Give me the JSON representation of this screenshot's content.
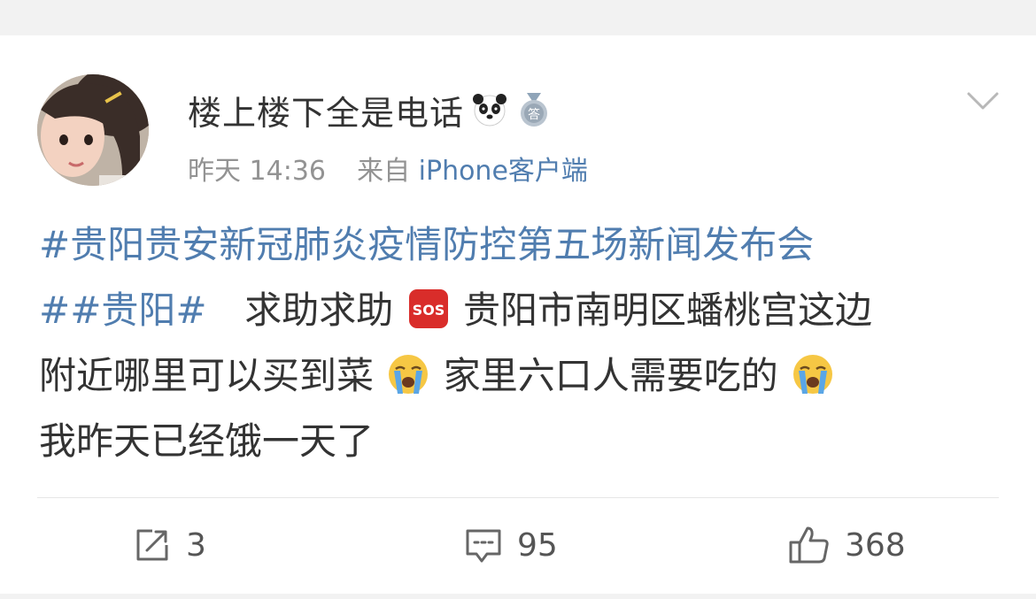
{
  "user": {
    "name": "楼上楼下全是电话",
    "avatar_icon": "avatar-photo-girl",
    "badges": [
      "panda-emoji-icon",
      "medal-badge-icon"
    ]
  },
  "post_meta": {
    "time": "昨天 14:36",
    "from_label": "来自",
    "source": "iPhone客户端"
  },
  "menu": {
    "icon": "chevron-down-icon"
  },
  "content": {
    "topic1": "#贵阳贵安新冠肺炎疫情防控第五场新闻发布会",
    "topic2": "##贵阳#",
    "text1": "求助求助",
    "text2": "贵阳市南明区蟠桃宫这边",
    "text3": "附近哪里可以买到菜",
    "text4": "家里六口人需要吃的",
    "text5": "我昨天已经饿一天了",
    "emojis": [
      "sos-emoji-icon",
      "crying-face-emoji-icon"
    ]
  },
  "actions": {
    "repost_count": "3",
    "comment_count": "95",
    "like_count": "368"
  },
  "colors": {
    "link": "#507daf",
    "text": "#333333",
    "meta": "#939393",
    "background": "#f2f2f2",
    "sos_red": "#d92d2a",
    "crying_yellow": "#f6c744",
    "tear_blue": "#5aa6e6"
  }
}
